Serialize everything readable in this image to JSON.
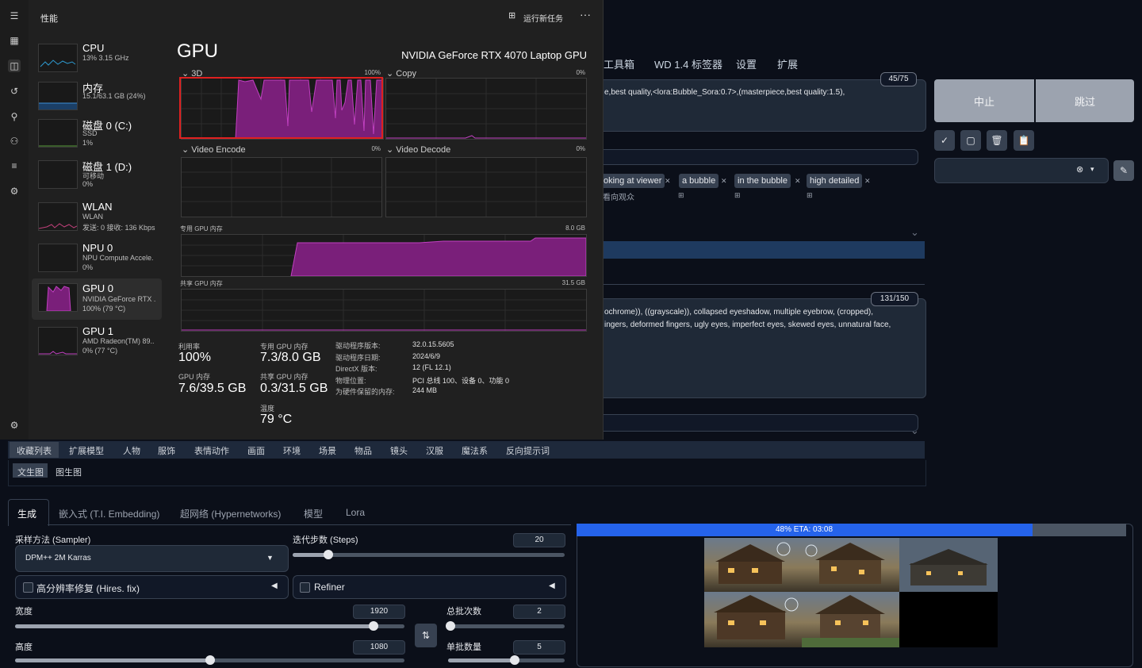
{
  "webui": {
    "top_tabs": [
      "工具箱",
      "WD 1.4 标签器",
      "设置",
      "扩展"
    ],
    "pos_prompt": "e,best quality,<lora:Bubble_Sora:0.7>,(masterpiece,best quality:1.5),",
    "pos_counter": "45/75",
    "neg_prompt_line1": "ochrome)), ((grayscale)), collapsed eyeshadow, multiple eyebrow, (cropped),",
    "neg_prompt_line2": "ingers, deformed fingers, ugly eyes, imperfect eyes, skewed eyes, unnatural face,",
    "neg_counter": "131/150",
    "interrupt_label": "中止",
    "skip_label": "跳过",
    "tags": [
      {
        "en": "oking at viewer",
        "zh": "看向观众"
      },
      {
        "en": "a bubble",
        "zh": ""
      },
      {
        "en": "in the bubble",
        "zh": ""
      },
      {
        "en": "high detailed",
        "zh": ""
      }
    ],
    "category_tabs": [
      "收藏列表",
      "扩展模型",
      "人物",
      "服饰",
      "表情动作",
      "画面",
      "环境",
      "场景",
      "物品",
      "镜头",
      "汉服",
      "魔法系",
      "反向提示词"
    ],
    "sub_tabs": [
      "文生图",
      "图生图"
    ],
    "gen_tabs": [
      "生成",
      "嵌入式 (T.I. Embedding)",
      "超网络 (Hypernetworks)",
      "模型",
      "Lora"
    ],
    "sampler_label": "采样方法 (Sampler)",
    "sampler_value": "DPM++ 2M Karras",
    "steps_label": "迭代步数 (Steps)",
    "steps_value": "20",
    "steps_fraction": 0.13,
    "hires_label": "高分辨率修复 (Hires. fix)",
    "refiner_label": "Refiner",
    "width_label": "宽度",
    "width_value": "1920",
    "width_fraction": 0.92,
    "height_label": "高度",
    "height_value": "1080",
    "height_fraction": 0.5,
    "batch_count_label": "总批次数",
    "batch_count_value": "2",
    "batch_count_fraction": 0.02,
    "batch_size_label": "单批数量",
    "batch_size_value": "5",
    "batch_size_fraction": 0.57,
    "progress_text": "48% ETA: 03:08",
    "progress_fraction": 0.48
  },
  "taskmgr": {
    "window_title": "性能",
    "run_task_label": "运行新任务",
    "more_label": "···",
    "items": [
      {
        "name": "CPU",
        "sub1": "13% 3.15 GHz",
        "sub2": "",
        "sub3": ""
      },
      {
        "name": "内存",
        "sub1": "15.1/63.1 GB (24%)",
        "sub2": "",
        "sub3": ""
      },
      {
        "name": "磁盘 0 (C:)",
        "sub1": "SSD",
        "sub2": "1%",
        "sub3": ""
      },
      {
        "name": "磁盘 1 (D:)",
        "sub1": "可移动",
        "sub2": "0%",
        "sub3": ""
      },
      {
        "name": "WLAN",
        "sub1": "WLAN",
        "sub2": "发送: 0 接收: 136 Kbps",
        "sub3": ""
      },
      {
        "name": "NPU 0",
        "sub1": "NPU Compute Accele.",
        "sub2": "0%",
        "sub3": ""
      },
      {
        "name": "GPU 0",
        "sub1": "NVIDIA GeForce RTX .",
        "sub2": "100% (79 °C)",
        "sub3": ""
      },
      {
        "name": "GPU 1",
        "sub1": "AMD Radeon(TM) 89..",
        "sub2": "0% (77 °C)",
        "sub3": ""
      }
    ],
    "heading": "GPU",
    "gpu_model": "NVIDIA GeForce RTX 4070 Laptop GPU",
    "graph_3d": "3D",
    "graph_3d_max": "100%",
    "graph_copy": "Copy",
    "graph_copy_max": "0%",
    "graph_venc": "Video Encode",
    "graph_venc_max": "0%",
    "graph_vdec": "Video Decode",
    "graph_vdec_max": "0%",
    "dedicated_label": "专用 GPU 内存",
    "dedicated_max": "8.0 GB",
    "shared_label": "共享 GPU 内存",
    "shared_max": "31.5 GB",
    "stats": {
      "util_label": "利用率",
      "util_value": "100%",
      "ded_label": "专用 GPU 内存",
      "ded_value": "7.3/8.0 GB",
      "gpumem_label": "GPU 内存",
      "gpumem_value": "7.6/39.5 GB",
      "shared_label": "共享 GPU 内存",
      "shared_value": "0.3/31.5 GB",
      "temp_label": "温度",
      "temp_value": "79 °C"
    },
    "info": [
      {
        "k": "驱动程序版本:",
        "v": "32.0.15.5605"
      },
      {
        "k": "驱动程序日期:",
        "v": "2024/6/9"
      },
      {
        "k": "DirectX 版本:",
        "v": "12 (FL 12.1)"
      },
      {
        "k": "物理位置:",
        "v": "PCI 总线 100、设备 0、功能 0"
      },
      {
        "k": "为硬件保留的内存:",
        "v": "244 MB"
      }
    ],
    "colors": {
      "gpu_fill": "#7a1f7a",
      "gpu_line": "#c040c0",
      "highlight": "#e02020"
    }
  }
}
